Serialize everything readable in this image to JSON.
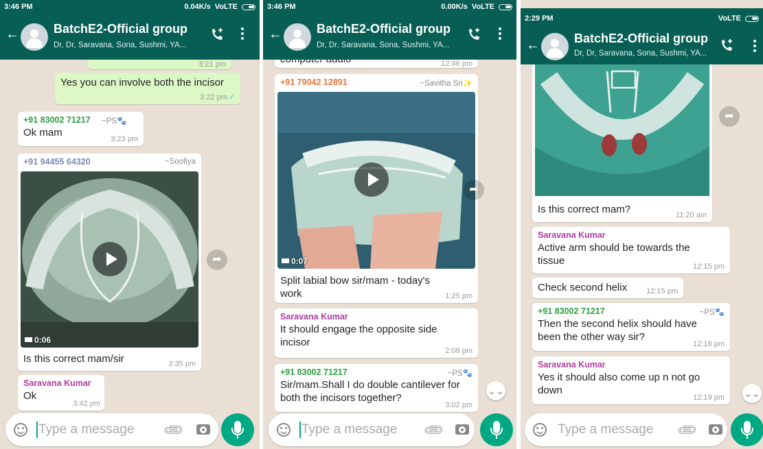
{
  "app": {
    "group_title": "BatchE2-Official group",
    "group_subtitle": "Dr, Dr, Saravana, Sona, Sushmi, YA...",
    "input_placeholder": "Type a message",
    "colors": {
      "header": "#075e54",
      "chat_bg": "#e9dfd4",
      "outgoing": "#dcf8c6",
      "accent": "#00a884"
    }
  },
  "panels": [
    {
      "status_time": "3:46 PM",
      "status_right": "0.04K/s",
      "status_net": "VoLTE",
      "messages": [
        {
          "time": "3:21 pm"
        },
        {
          "text": "Yes you can involve both the incisor",
          "time": "3:22 pm",
          "tick": "✓"
        },
        {
          "sender": "+91 83002 71217",
          "pushname": "~PS",
          "text": "Ok mam",
          "time": "3:23 pm"
        },
        {
          "sender": "+91 94455 64320",
          "pushname": "~Soofiya",
          "duration": "0:06",
          "text": "Is this correct mam/sir",
          "time": "3:35 pm"
        },
        {
          "sender": "Saravana Kumar",
          "text": "Ok",
          "time": "3:42 pm"
        }
      ]
    },
    {
      "status_time": "3:46 PM",
      "status_right": "0.00K/s",
      "status_net": "VoLTE",
      "messages": [
        {
          "text": "computer audio",
          "time": "12:46 pm"
        },
        {
          "sender": "+91 79042 12891",
          "pushname": "~Savitha Sri",
          "duration": "0:07",
          "text": "Split labial bow sir/mam - today's work",
          "time": "1:25 pm"
        },
        {
          "sender": "Saravana Kumar",
          "text": "It should engage the opposite side incisor",
          "time": "2:08 pm"
        },
        {
          "sender": "+91 83002 71217",
          "pushname": "~PS",
          "text": "Sir/mam.Shall I do double cantilever for both the incisors together?",
          "time": "3:02 pm"
        }
      ]
    },
    {
      "status_time": "2:29 PM",
      "status_right": "",
      "status_net": "VoLTE",
      "messages": [
        {
          "text": "Is this correct mam?",
          "time": "11:20 am"
        },
        {
          "sender": "Saravana Kumar",
          "text": "Active arm should be towards the tissue",
          "time": "12:15 pm"
        },
        {
          "text": "Check second helix",
          "time": "12:15 pm"
        },
        {
          "sender": "+91 83002 71217",
          "pushname": "~PS",
          "text": "Then the second helix should have been the other way sir?",
          "time": "12:18 pm"
        },
        {
          "sender": "Saravana Kumar",
          "text": "Yes it should also come up n not go down",
          "time": "12:19 pm"
        }
      ]
    }
  ]
}
